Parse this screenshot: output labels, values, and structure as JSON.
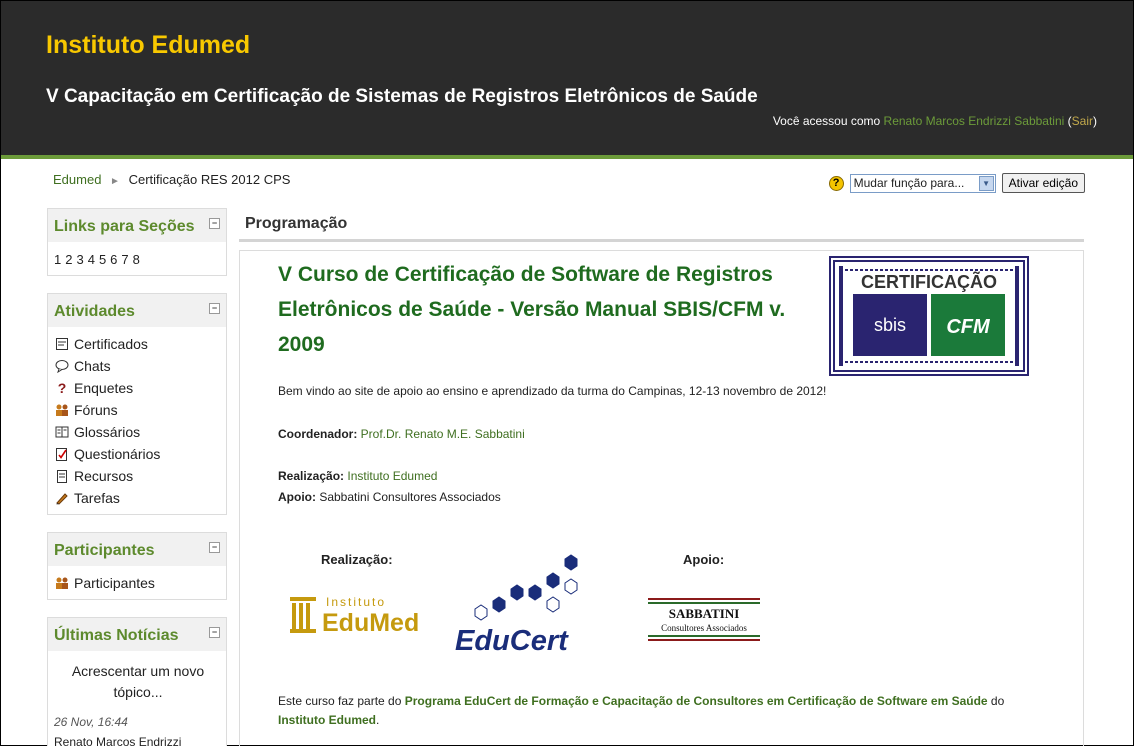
{
  "header": {
    "site_title": "Instituto Edumed",
    "course_title": "V Capacitação em Certificação de Sistemas de Registros Eletrônicos de Saúde",
    "login_prefix": "Você acessou como ",
    "user_name": "Renato Marcos Endrizzi Sabbatini",
    "logout_open": " (",
    "logout_label": "Sair",
    "logout_close": ")"
  },
  "navbar": {
    "home": "Edumed",
    "separator": "►",
    "current": "Certificação RES 2012 CPS",
    "help_icon": "?",
    "role_select_value": "Mudar função para...",
    "edit_button": "Ativar edição"
  },
  "blocks": {
    "sections": {
      "title": "Links para Seções",
      "collapse": "−",
      "links": [
        "1",
        "2",
        "3",
        "4",
        "5",
        "6",
        "7",
        "8"
      ]
    },
    "activities": {
      "title": "Atividades",
      "collapse": "−",
      "items": [
        {
          "label": "Certificados",
          "icon": "certificate-icon"
        },
        {
          "label": "Chats",
          "icon": "chat-icon"
        },
        {
          "label": "Enquetes",
          "icon": "question-icon"
        },
        {
          "label": "Fóruns",
          "icon": "forum-icon"
        },
        {
          "label": "Glossários",
          "icon": "glossary-icon"
        },
        {
          "label": "Questionários",
          "icon": "quiz-icon"
        },
        {
          "label": "Recursos",
          "icon": "resource-icon"
        },
        {
          "label": "Tarefas",
          "icon": "assignment-icon"
        }
      ]
    },
    "participants": {
      "title": "Participantes",
      "collapse": "−",
      "item": "Participantes"
    },
    "news": {
      "title": "Últimas Notícias",
      "collapse": "−",
      "add_line1": "Acrescentar um novo",
      "add_line2": "tópico...",
      "date": "26 Nov, 16:44",
      "author": "Renato Marcos Endrizzi"
    }
  },
  "main": {
    "section_title": "Programação",
    "course_heading": "V Curso de Certificação de Software de Registros Eletrônicos de Saúde - Versão Manual SBIS/CFM v. 2009",
    "cert_logo": {
      "top": "CERTIFICAÇÃO",
      "left": "sbis",
      "right": "CFM"
    },
    "welcome": "Bem vindo ao site de apoio ao ensino e aprendizado da turma do Campinas, 12-13 novembro de 2012!",
    "coordinator_label": "Coordenador:",
    "coordinator_value": " Prof.Dr. Renato M.E. Sabbatini",
    "realizacao_label": "Realização:",
    "realizacao_value": " Instituto Edumed",
    "apoio_label": "Apoio:",
    "apoio_value": " Sabbatini Consultores Associados",
    "logos": {
      "realizacao_label": "Realização:",
      "apoio_label": "Apoio:",
      "edumed_small": "Instituto",
      "edumed_big": "EduMed",
      "educert": "EduCert",
      "sabbatini_big": "SABBATINI",
      "sabbatini_small": "Consultores Associados"
    },
    "footer_prefix": "Este curso faz parte do ",
    "footer_link1": "Programa EduCert de Formação e Capacitação de Consultores em Certificação de Software em Saúde",
    "footer_middle": " do ",
    "footer_link2": "Instituto Edumed",
    "footer_end": "."
  },
  "colors": {
    "header_bg": "#2b2b2b",
    "accent_green": "#6c9b3a",
    "site_title": "#f8c800",
    "heading_green": "#1f6b1f"
  }
}
